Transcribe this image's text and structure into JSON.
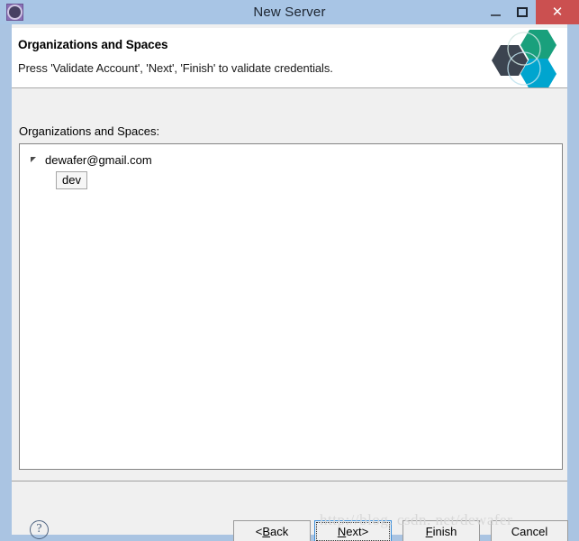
{
  "window": {
    "title": "New Server",
    "icon": "server-gear-icon",
    "controls": {
      "minimize": "–",
      "maximize": "□",
      "close": "✕"
    },
    "colors": {
      "titlebar": "#a8c5e5",
      "close_button": "#cb5050",
      "body": "#f0f0f0",
      "focus_border": "#3c8fdb"
    }
  },
  "banner": {
    "title": "Organizations and Spaces",
    "description": "Press 'Validate Account', 'Next', 'Finish' to validate credentials.",
    "logo": {
      "name": "cloud-foundry-hexagon-logo",
      "hex_dark": "#3c4450",
      "hex_green": "#19a07c",
      "hex_cyan": "#00a5cf"
    }
  },
  "page": {
    "tree_label": "Organizations and Spaces:",
    "tree": {
      "account": {
        "label": "dewafer@gmail.com",
        "expanded": true,
        "twisty": "expanded-triangle-icon"
      },
      "space": {
        "label": "dev",
        "selected": true
      }
    }
  },
  "buttonbar": {
    "help": "?",
    "back": {
      "prefix": "< ",
      "mnemonic": "B",
      "rest": "ack"
    },
    "next": {
      "mnemonic": "N",
      "rest": "ext",
      "suffix": " >",
      "focused": true
    },
    "finish": {
      "mnemonic": "F",
      "rest": "inish"
    },
    "cancel": {
      "label": "Cancel"
    }
  },
  "watermark": {
    "text": "http://blog. csdn. net/dewafer"
  }
}
